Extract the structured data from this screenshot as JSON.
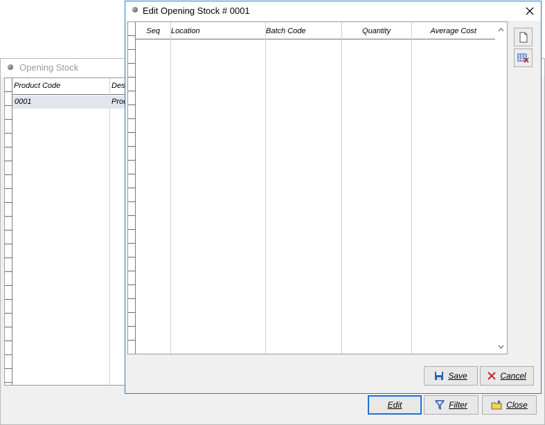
{
  "background_window": {
    "title": "Opening Stock",
    "columns": [
      "Product Code",
      "Desc"
    ],
    "rows": [
      {
        "product_code": "0001",
        "description": "Prod"
      }
    ],
    "buttons": {
      "edit": "Edit",
      "filter": "Filter",
      "close": "Close"
    }
  },
  "dialog": {
    "title": "Edit Opening Stock # 0001",
    "columns": [
      "Seq",
      "Location",
      "Batch Code",
      "Quantity",
      "Average Cost"
    ],
    "buttons": {
      "save": "Save",
      "cancel": "Cancel"
    }
  },
  "colors": {
    "accent": "#1883d7",
    "selected_row": "#e4e4ee",
    "cancel_icon": "#c0282d",
    "filter_icon": "#1f4fa8"
  },
  "icons": [
    "window-dot-icon",
    "close-icon",
    "new-document-icon",
    "delete-row-icon",
    "chevron-up-icon",
    "chevron-down-icon",
    "floppy-disk-icon",
    "cancel-x-icon",
    "funnel-icon",
    "folder-close-icon"
  ]
}
